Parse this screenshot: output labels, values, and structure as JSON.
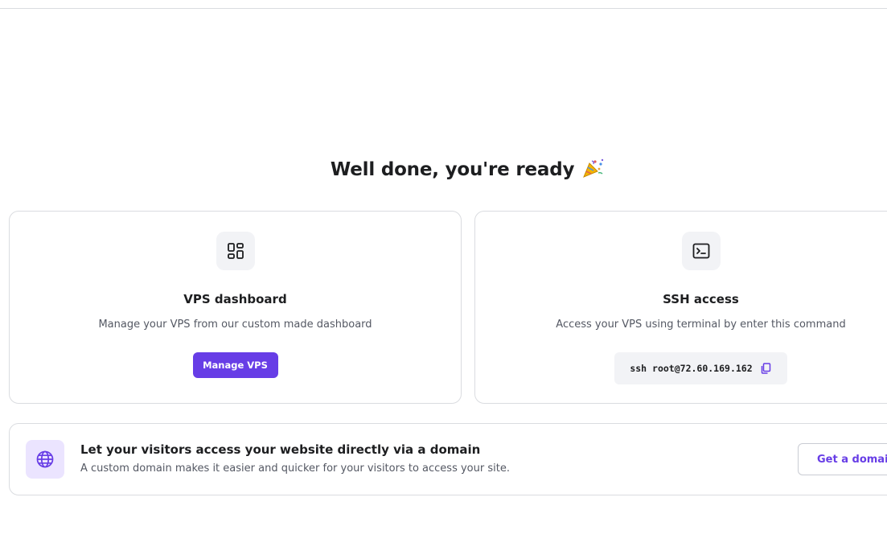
{
  "header": {
    "title": "Well done, you're ready",
    "emoji": "party-popper"
  },
  "vps_card": {
    "icon": "dashboard-icon",
    "title": "VPS dashboard",
    "description": "Manage your VPS from our custom made dashboard",
    "button_label": "Manage VPS"
  },
  "ssh_card": {
    "icon": "terminal-icon",
    "title": "SSH access",
    "description": "Access your VPS using terminal by enter this command",
    "command": "ssh root@72.60.169.162",
    "copy_icon": "copy-icon"
  },
  "domain_banner": {
    "icon": "globe-icon",
    "title": "Let your visitors access your website directly via a domain",
    "description": "A custom domain makes it easier and quicker for your visitors to access your site.",
    "button_label": "Get a domain"
  },
  "colors": {
    "accent": "#673de6",
    "accent_light": "#ebe4ff",
    "border": "#dadce0",
    "tile_bg": "#f2f3f6"
  }
}
